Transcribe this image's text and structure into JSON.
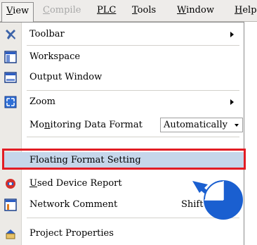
{
  "menubar": {
    "items": [
      {
        "label": "View",
        "accel": "V",
        "state": "active"
      },
      {
        "label": "Compile",
        "accel": "C",
        "state": "disabled"
      },
      {
        "label": "PLC",
        "accel": "P",
        "state": "normal"
      },
      {
        "label": "Tools",
        "accel": "T",
        "state": "normal"
      },
      {
        "label": "Window",
        "accel": "W",
        "state": "normal"
      },
      {
        "label": "Help",
        "accel": "H",
        "state": "normal",
        "visible_text": "Help"
      }
    ]
  },
  "menu": {
    "toolbar": {
      "label": "Toolbar",
      "icon": "tools-icon",
      "has_submenu": true
    },
    "workspace": {
      "label": "Workspace",
      "icon": "workspace-icon"
    },
    "output_window": {
      "label": "Output Window",
      "icon": "output-window-icon"
    },
    "zoom": {
      "label": "Zoom",
      "icon": "zoom-icon",
      "has_submenu": true
    },
    "monitoring": {
      "label": "Monitoring Data Format",
      "accel": "n",
      "value": "Automatically"
    },
    "floating": {
      "label": "Floating Format Setting",
      "highlighted": true
    },
    "used_device": {
      "label": "Used Device Report",
      "accel": "U",
      "icon": "device-report-icon"
    },
    "network_comment": {
      "label": "Network Comment",
      "shortcut": "Shift+",
      "icon": "network-comment-icon"
    },
    "project_properties": {
      "label": "Project Properties",
      "icon": "project-properties-icon"
    }
  },
  "annotation": {
    "callout": "pointer-arrow",
    "frame_color": "#e21c24",
    "arrow_color": "#1a5fd0"
  },
  "colors": {
    "menubar_bg": "#eeecea",
    "gutter_bg": "#eceae6",
    "highlight_bg": "#c5d6ea",
    "disabled_text": "#a8a8a8"
  }
}
